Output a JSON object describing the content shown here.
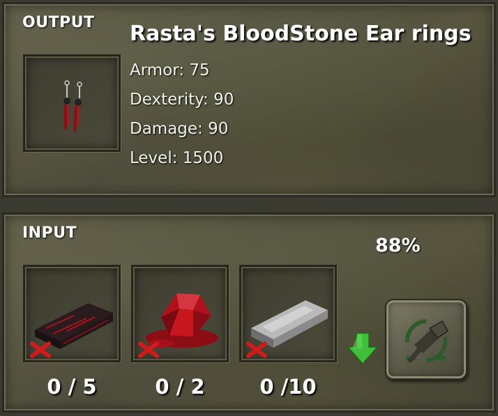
{
  "output": {
    "label": "OUTPUT",
    "item_name": "Rasta's BloodStone Ear rings",
    "item_icon": "bloodstone-earrings-icon",
    "stats": [
      {
        "text": "Armor: 75"
      },
      {
        "text": "Dexterity: 90"
      },
      {
        "text": "Damage: 90"
      },
      {
        "text": "Level: 1500"
      }
    ]
  },
  "input": {
    "label": "INPUT",
    "success_rate": "88%",
    "ingredients": [
      {
        "icon": "dark-bloodstone-bar-icon",
        "count": "0 / 5",
        "missing": true
      },
      {
        "icon": "blood-gem-icon",
        "count": "0 / 2",
        "missing": true
      },
      {
        "icon": "silver-ingot-icon",
        "count": "0 /10",
        "missing": true
      }
    ],
    "craft_button_icon": "hammer-craft-icon",
    "arrow_icon": "down-arrow-icon",
    "colors": {
      "arrow": "#3fbf3a",
      "missing_mark": "#d21a1a",
      "blood": "#a0111a"
    }
  }
}
